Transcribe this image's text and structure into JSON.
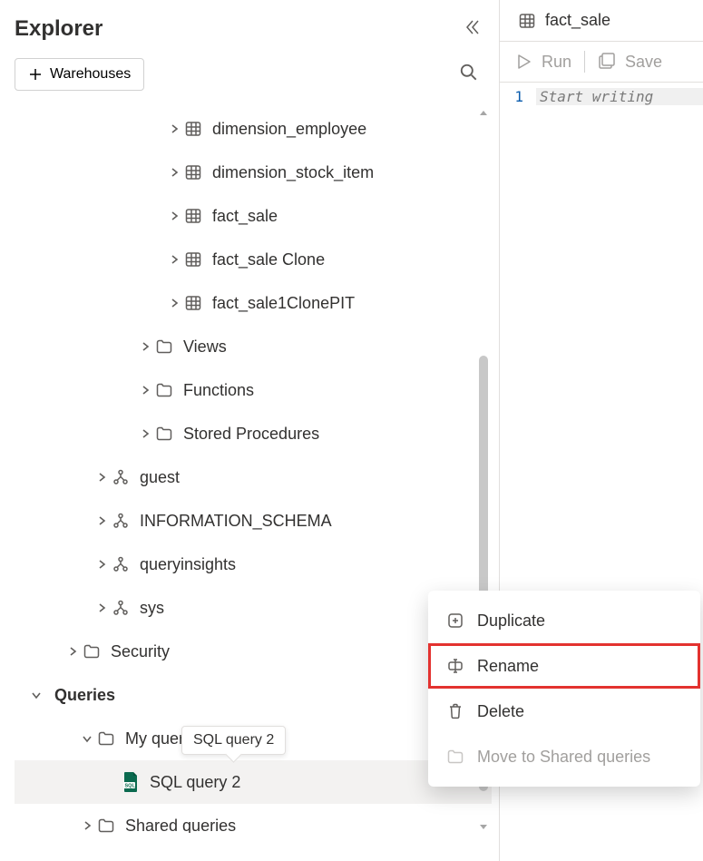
{
  "explorer": {
    "title": "Explorer",
    "warehouses_button": "Warehouses",
    "tree": {
      "tables": [
        "dimension_employee",
        "dimension_stock_item",
        "fact_sale",
        "fact_sale Clone",
        "fact_sale1ClonePIT"
      ],
      "schema_folders": [
        "Views",
        "Functions",
        "Stored Procedures"
      ],
      "schemas": [
        "guest",
        "INFORMATION_SCHEMA",
        "queryinsights",
        "sys"
      ],
      "security": "Security",
      "queries_section": "Queries",
      "my_queries": "My quer",
      "my_queries_full": "My queries",
      "selected_query": "SQL query 2",
      "shared_queries": "Shared queries"
    },
    "tooltip": "SQL query 2"
  },
  "contextMenu": {
    "duplicate": "Duplicate",
    "rename": "Rename",
    "delete": "Delete",
    "move": "Move to Shared queries"
  },
  "editor": {
    "tab_title": "fact_sale",
    "run": "Run",
    "save": "Save",
    "line_number": "1",
    "placeholder": "Start writing"
  }
}
